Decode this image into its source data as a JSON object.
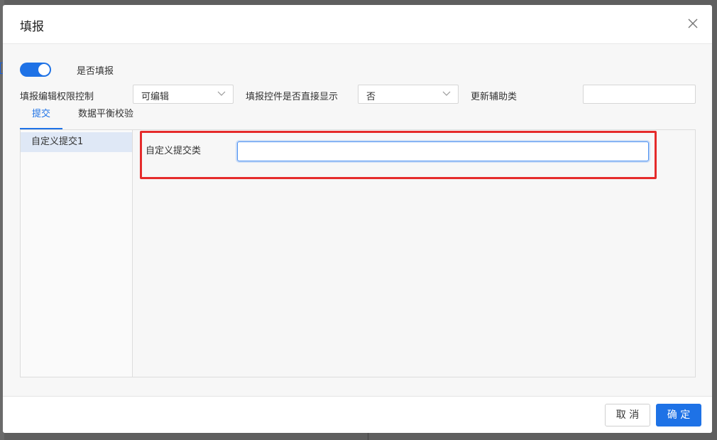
{
  "dialog": {
    "title": "填报"
  },
  "toggle": {
    "label": "是否填报",
    "on": true,
    "color": "#1e72e6"
  },
  "fields": {
    "edit_permission_label": "填报编辑权限控制",
    "edit_permission_value": "可编辑",
    "direct_display_label": "填报控件是否直接显示",
    "direct_display_value": "否",
    "update_aux_label": "更新辅助类",
    "update_aux_value": ""
  },
  "tabs": [
    {
      "label": "提交",
      "active": true
    },
    {
      "label": "数据平衡校验",
      "active": false
    }
  ],
  "submit_list": [
    {
      "label": "自定义提交1",
      "selected": true
    }
  ],
  "custom_submit": {
    "field_label": "自定义提交类",
    "value": ""
  },
  "footer": {
    "cancel_label": "取 消",
    "ok_label": "确 定"
  },
  "colors": {
    "accent": "#1e72e6",
    "highlight_border": "#e52b2b"
  }
}
